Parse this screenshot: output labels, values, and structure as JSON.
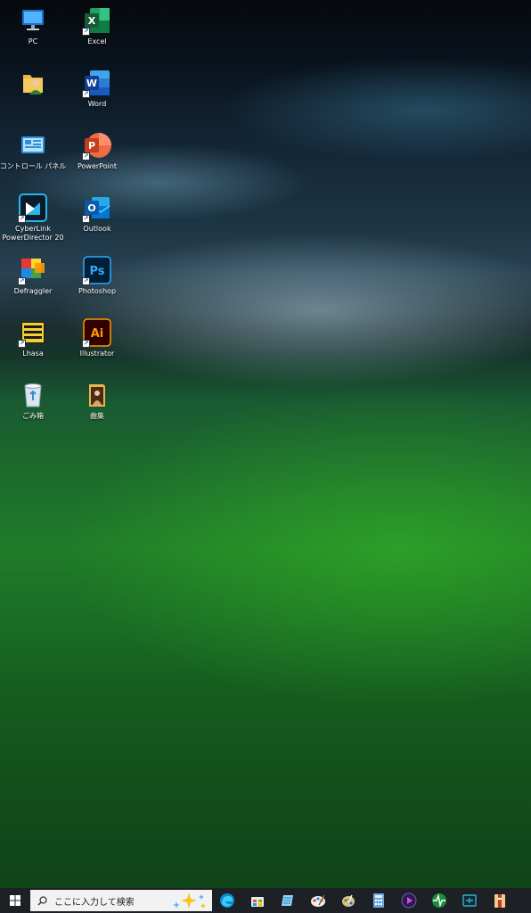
{
  "desktop": {
    "icons": [
      {
        "id": "pc",
        "label": "PC"
      },
      {
        "id": "excel",
        "label": "Excel"
      },
      {
        "id": "user-folder",
        "label": ""
      },
      {
        "id": "word",
        "label": "Word"
      },
      {
        "id": "control-panel",
        "label": "コントロール パネル"
      },
      {
        "id": "powerpoint",
        "label": "PowerPoint"
      },
      {
        "id": "cyberlink",
        "label": "CyberLink",
        "label2": "PowerDirector 20"
      },
      {
        "id": "outlook",
        "label": "Outlook"
      },
      {
        "id": "defraggler",
        "label": "Defraggler"
      },
      {
        "id": "photoshop",
        "label": "Photoshop"
      },
      {
        "id": "lhasa",
        "label": "Lhasa"
      },
      {
        "id": "illustrator",
        "label": "Illustrator"
      },
      {
        "id": "recycle-bin",
        "label": "ごみ箱"
      },
      {
        "id": "music-folder",
        "label": "曲集"
      }
    ]
  },
  "taskbar": {
    "search_placeholder": "ここに入力して検索",
    "apps": [
      "edge-icon",
      "store-icon",
      "notepad-icon",
      "paint-icon",
      "image-viewer-icon",
      "calculator-icon",
      "media-player-icon",
      "activity-monitor-icon",
      "screen-capture-icon",
      "archive-tool-icon"
    ]
  },
  "colors": {
    "taskbar_bg": "#1d2126",
    "excel": "#1d7044",
    "word": "#2b5db8",
    "powerpoint": "#c4412a",
    "outlook": "#0f6cbd",
    "photoshop": "#001e36",
    "illustrator": "#330000"
  }
}
